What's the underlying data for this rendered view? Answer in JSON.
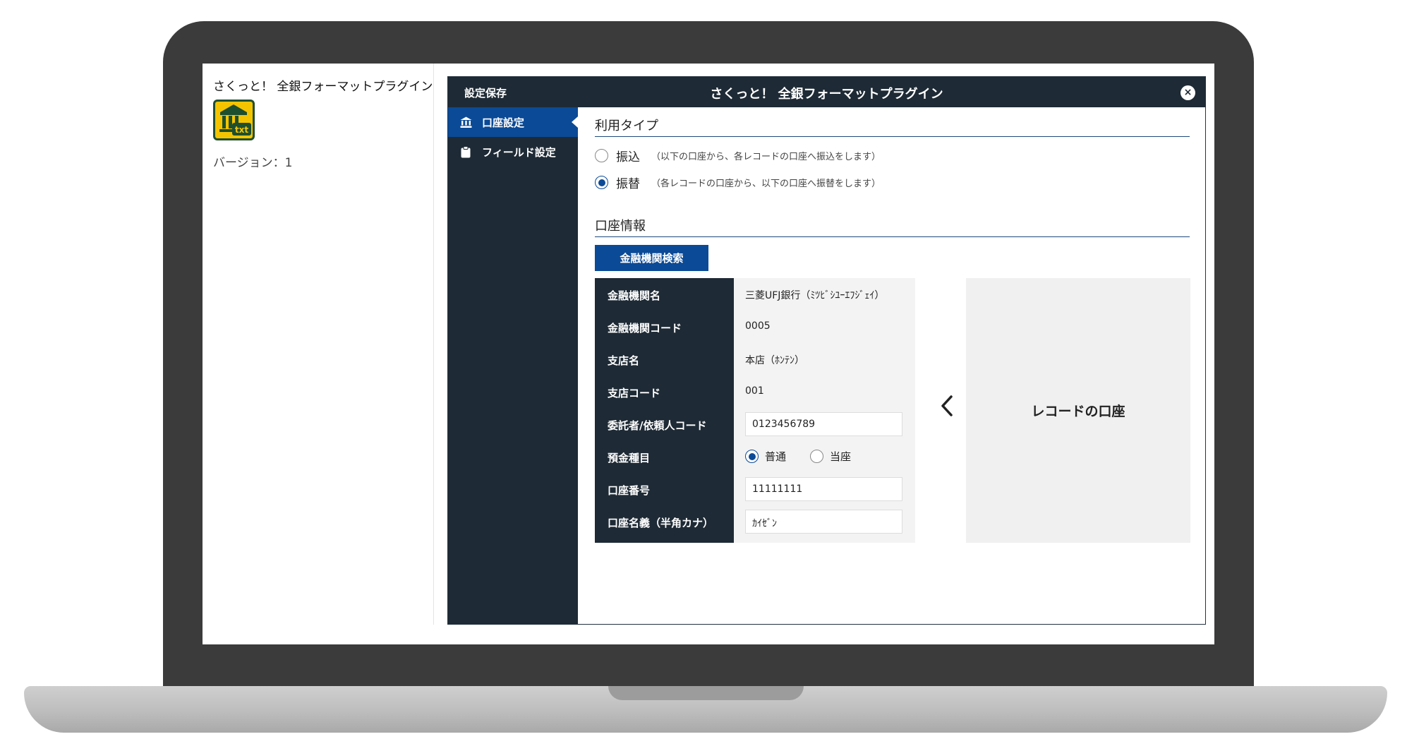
{
  "plugin": {
    "name": "さくっと！ 全銀フォーマットプラグイン",
    "icon": "bank-txt-icon",
    "version": "バージョン：1"
  },
  "dialog": {
    "save_label": "設定保存",
    "title": "さくっと！ 全銀フォーマットプラグイン",
    "close_icon": "×"
  },
  "sidebar": {
    "items": [
      {
        "label": "口座設定",
        "icon": "bank-icon",
        "active": true
      },
      {
        "label": "フィールド設定",
        "icon": "clipboard-icon",
        "active": false
      }
    ]
  },
  "usage": {
    "title": "利用タイプ",
    "options": [
      {
        "label": "振込",
        "desc": "（以下の口座から、各レコードの口座へ振込をします）",
        "checked": false
      },
      {
        "label": "振替",
        "desc": "（各レコードの口座から、以下の口座へ振替をします）",
        "checked": true
      }
    ]
  },
  "account": {
    "title": "口座情報",
    "search_button": "金融機関検索",
    "rows": [
      {
        "label": "金融機関名",
        "value": "三菱UFJ銀行（ﾐﾂﾋﾞｼﾕｰｴﾌｼﾞｪｲ）"
      },
      {
        "label": "金融機関コード",
        "value": "0005"
      },
      {
        "label": "支店名",
        "value": "本店（ﾎﾝﾃﾝ）"
      },
      {
        "label": "支店コード",
        "value": "001"
      },
      {
        "label": "委託者/依頼人コード",
        "value": "0123456789"
      },
      {
        "label": "預金種目",
        "options": [
          {
            "label": "普通",
            "checked": true
          },
          {
            "label": "当座",
            "checked": false
          }
        ]
      },
      {
        "label": "口座番号",
        "value": "11111111"
      },
      {
        "label": "口座名義（半角カナ）",
        "value": "ｶｲｾﾞﾝ"
      }
    ],
    "arrow_icon": "chevron-left-icon",
    "record_label": "レコードの口座"
  },
  "colors": {
    "header": "#1e2a35",
    "accent": "#0b4a96",
    "laptop": "#3b3b3b"
  }
}
